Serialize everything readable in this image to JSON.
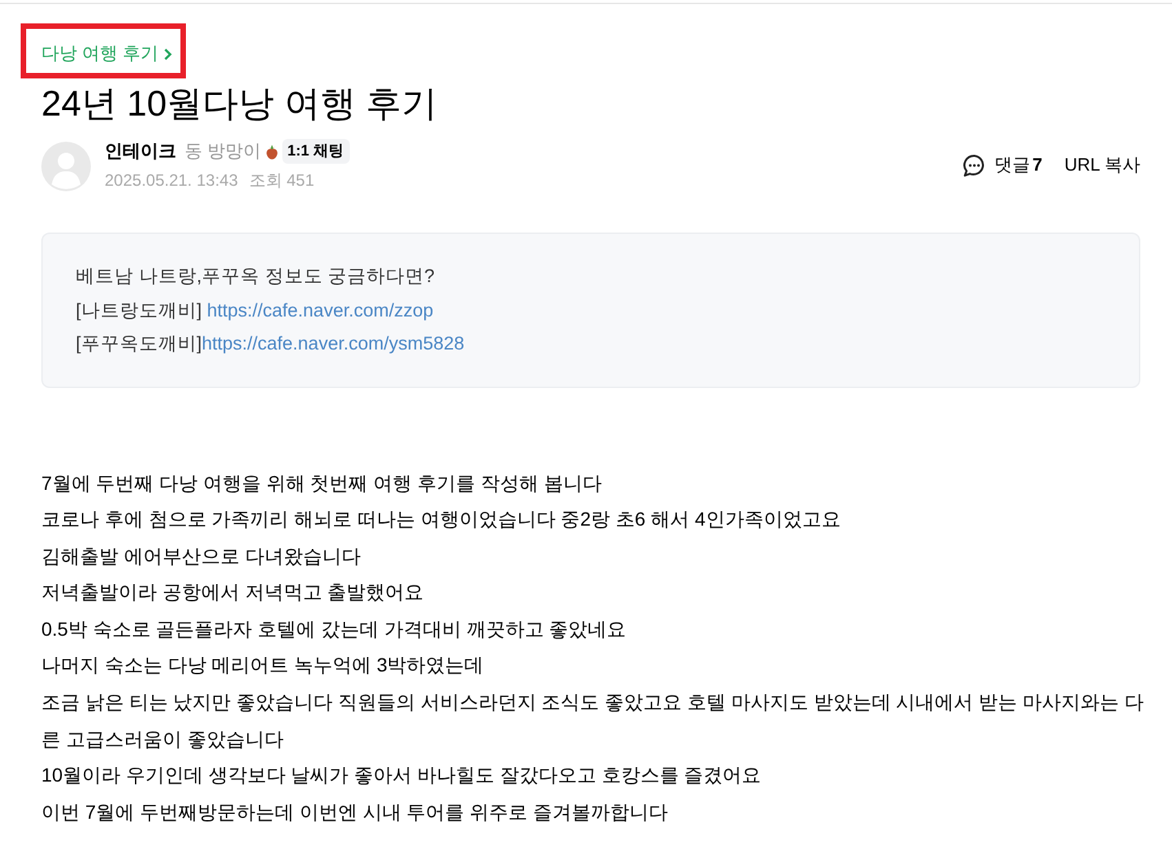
{
  "breadcrumb": {
    "label": "다낭 여행 후기",
    "highlighted": true
  },
  "title": "24년 10월다낭 여행 후기",
  "author": {
    "name": "인테이크",
    "rank": "동 방망이",
    "chat_button": "1:1 채팅",
    "date": "2025.05.21. 13:43",
    "views": "조회 451"
  },
  "actions": {
    "comments": {
      "label": "댓글",
      "count": "7"
    },
    "copy_url": "URL 복사"
  },
  "notice": {
    "lines": [
      {
        "text": "베트남 나트랑,푸꾸옥 정보도 궁금하다면?"
      },
      {
        "text": "[나트랑도깨비] ",
        "link": "https://cafe.naver.com/zzop"
      },
      {
        "text": "[푸꾸옥도깨비]",
        "link": "https://cafe.naver.com/ysm5828"
      }
    ]
  },
  "body": {
    "paragraphs": [
      "7월에 두번째 다낭 여행을 위해 첫번째 여행 후기를 작성해 봅니다",
      "코로나 후에 첨으로 가족끼리 해뇌로 떠나는 여행이었습니다 중2랑 초6 해서 4인가족이었고요",
      "김해출발 에어부산으로 다녀왔습니다",
      "저녁출발이라 공항에서 저녁먹고 출발했어요",
      "0.5박 숙소로 골든플라자 호텔에 갔는데 가격대비 깨끗하고 좋았네요",
      "나머지 숙소는 다낭 메리어트 녹누억에 3박하였는데",
      "조금 낡은 티는 났지만 좋았습니다 직원들의 서비스라던지 조식도 좋았고요 호텔 마사지도 받았는데 시내에서 받는 마사지와는 다른 고급스러움이 좋았습니다",
      "10월이라 우기인데 생각보다 날씨가 좋아서 바나힐도 잘갔다오고 호캉스를 즐겼어요",
      "이번 7월에 두번째방문하는데 이번엔 시내 투어를 위주로 즐겨볼까합니다"
    ]
  }
}
